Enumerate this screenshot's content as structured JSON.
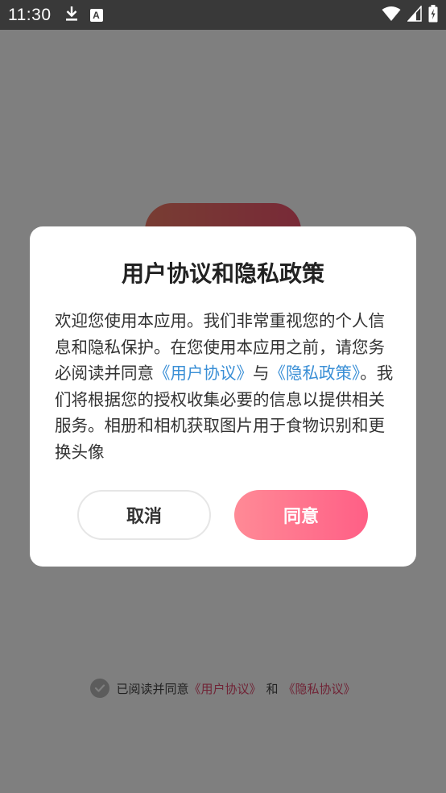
{
  "status_bar": {
    "time": "11:30",
    "download_icon": "download-icon",
    "a_icon_letter": "A",
    "wifi_icon": "wifi-icon",
    "signal_icon": "signal-icon",
    "battery_icon": "battery-charging-icon"
  },
  "background": {
    "agree_prefix": "已阅读并同意",
    "user_agreement_link": "《用户协议》",
    "and_text": "和",
    "privacy_agreement_link": "《隐私协议》"
  },
  "dialog": {
    "title": "用户协议和隐私政策",
    "body_part1": "欢迎您使用本应用。我们非常重视您的个人信息和隐私保护。在您使用本应用之前，请您务必阅读并同意",
    "user_agreement_link": "《用户协议》",
    "body_part2": "与",
    "privacy_policy_link": "《隐私政策》",
    "body_part3": "。我们将根据您的授权收集必要的信息以提供相关服务。相册和相机获取图片用于食物识别和更换头像",
    "cancel_label": "取消",
    "agree_label": "同意"
  },
  "colors": {
    "accent": "#ff5f86",
    "link": "#3a8fd6",
    "background_link": "#e0486c"
  }
}
